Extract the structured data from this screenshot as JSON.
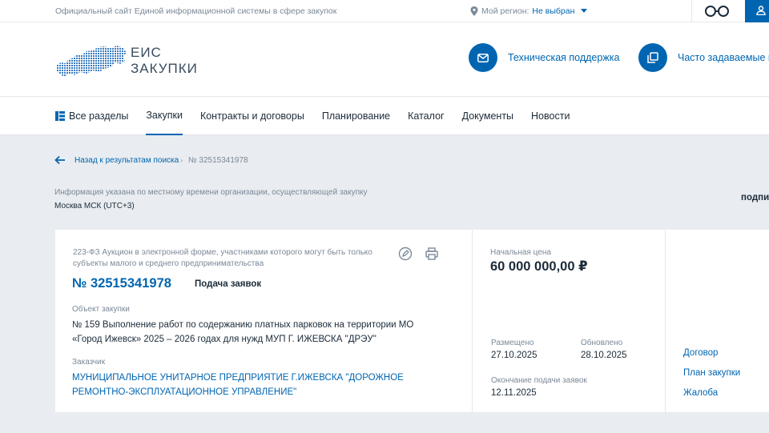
{
  "topbar": {
    "site_name": "Официальный сайт Единой информационной системы в сфере закупок",
    "region_label": "Мой регион:",
    "region_value": "Не выбран"
  },
  "header": {
    "logo_line1": "ЕИС",
    "logo_line2": "ЗАКУПКИ",
    "support": "Техническая поддержка",
    "faq": "Часто задаваемые в"
  },
  "nav": {
    "items": [
      "Все разделы",
      "Закупки",
      "Контракты и договоры",
      "Планирование",
      "Каталог",
      "Документы",
      "Новости"
    ]
  },
  "breadcrumb": {
    "back": "Назад к результатам поиска",
    "separator": "›",
    "current": "№ 32515341978"
  },
  "tz": {
    "note": "Информация указана по местному времени организации, осуществляющей закупку",
    "value": "Москва МСК (UTC+3)"
  },
  "subscribe": "подпи",
  "card": {
    "type": "223-ФЗ Аукцион в электронной форме, участниками которого могут быть только субъекты малого и среднего предпринимательства",
    "number": "№ 32515341978",
    "stage": "Подача заявок",
    "object_label": "Объект закупки",
    "object": "№ 159 Выполнение работ по содержанию платных парковок на территории МО «Город Ижевск» 2025 – 2026 годах для нужд МУП Г. ИЖЕВСКА \"ДРЭУ\"",
    "customer_label": "Заказчик",
    "customer": "МУНИЦИПАЛЬНОЕ УНИТАРНОЕ ПРЕДПРИЯТИЕ Г.ИЖЕВСКА \"ДОРОЖНОЕ РЕМОНТНО-ЭКСПЛУАТАЦИОННОЕ УПРАВЛЕНИЕ\"",
    "price_label": "Начальная цена",
    "price": "60 000 000,00 ₽",
    "posted_label": "Размещено",
    "posted": "27.10.2025",
    "updated_label": "Обновлено",
    "updated": "28.10.2025",
    "deadline_label": "Окончание подачи заявок",
    "deadline": "12.11.2025",
    "links": [
      "Договор",
      "План закупки",
      "Жалоба"
    ]
  },
  "colors": {
    "accent": "#0065b1",
    "background": "#e9ecf0",
    "muted_text": "#7b8897"
  }
}
